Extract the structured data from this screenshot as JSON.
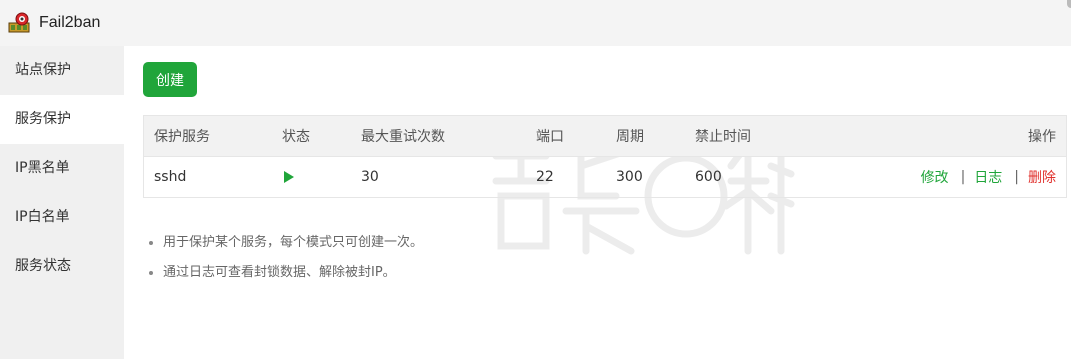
{
  "app": {
    "title": "Fail2ban"
  },
  "sidebar": {
    "items": [
      {
        "label": "站点保护",
        "active": false
      },
      {
        "label": "服务保护",
        "active": true
      },
      {
        "label": "IP黑名单",
        "active": false
      },
      {
        "label": "IP白名单",
        "active": false
      },
      {
        "label": "服务状态",
        "active": false
      }
    ]
  },
  "toolbar": {
    "create_label": "创建"
  },
  "table": {
    "headers": {
      "service": "保护服务",
      "status": "状态",
      "max_retry": "最大重试次数",
      "port": "端口",
      "period": "周期",
      "ban_time": "禁止时间",
      "actions": "操作"
    },
    "rows": [
      {
        "service": "sshd",
        "status_icon": "play-icon",
        "max_retry": "30",
        "port": "22",
        "period": "300",
        "ban_time": "600",
        "actions": {
          "edit": "修改",
          "log": "日志",
          "delete": "删除",
          "separator": "|"
        }
      }
    ]
  },
  "notes": [
    "用于保护某个服务，每个模式只可创建一次。",
    "通过日志可查看封锁数据、解除被封IP。"
  ],
  "colors": {
    "accent": "#20a53a",
    "danger": "#e0312d",
    "sidebar_bg": "#f0f0f0",
    "titlebar_bg": "#f4f4f4",
    "table_header_bg": "#f2f2f2"
  },
  "icons": {
    "app": "fail2ban-logo-icon",
    "status": "play-icon"
  }
}
